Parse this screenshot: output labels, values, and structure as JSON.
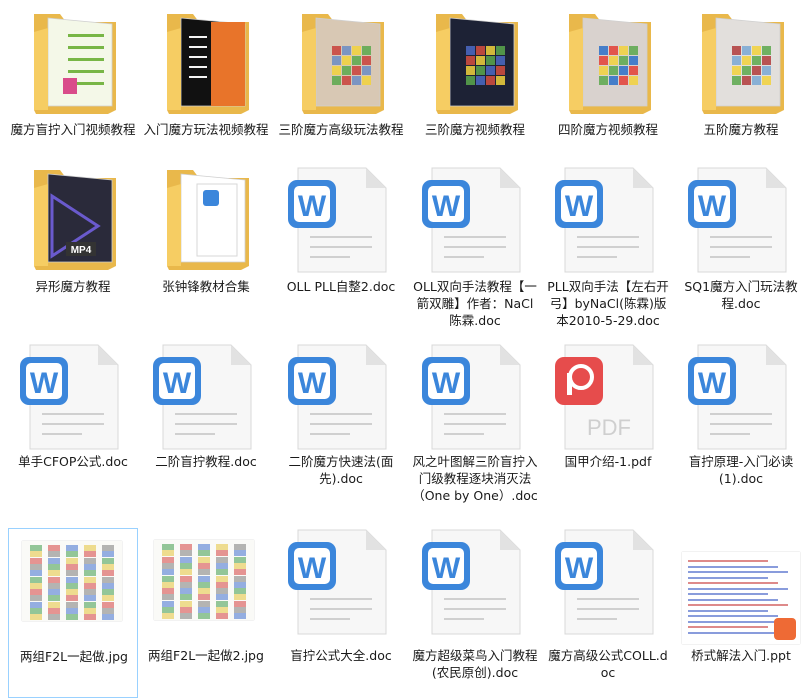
{
  "files": [
    {
      "name": "魔方盲拧入门视频教程",
      "type": "folder",
      "theme": "green"
    },
    {
      "name": "入门魔方玩法视频教程",
      "type": "folder",
      "theme": "orange"
    },
    {
      "name": "三阶魔方高级玩法教程",
      "type": "folder",
      "theme": "photo"
    },
    {
      "name": "三阶魔方视频教程",
      "type": "folder",
      "theme": "dark"
    },
    {
      "name": "四阶魔方视频教程",
      "type": "folder",
      "theme": "cube"
    },
    {
      "name": "五阶魔方教程",
      "type": "folder",
      "theme": "cube2"
    },
    {
      "name": "异形魔方教程",
      "type": "folder",
      "theme": "mp4"
    },
    {
      "name": "张钟锋教材合集",
      "type": "folder",
      "theme": "word"
    },
    {
      "name": "OLL PLL自整2.doc",
      "type": "doc"
    },
    {
      "name": "OLL双向手法教程【一箭双雕】作者：NaCl陈霖.doc",
      "type": "doc"
    },
    {
      "name": "PLL双向手法【左右开弓】byNaCl(陈霖)版本2010-5-29.doc",
      "type": "doc"
    },
    {
      "name": "SQ1魔方入门玩法教程.doc",
      "type": "doc"
    },
    {
      "name": "单手CFOP公式.doc",
      "type": "doc"
    },
    {
      "name": "二阶盲拧教程.doc",
      "type": "doc"
    },
    {
      "name": "二阶魔方快速法(面先).doc",
      "type": "doc"
    },
    {
      "name": "风之叶图解三阶盲拧入门级教程逐块消灭法（One by One）.doc",
      "type": "doc"
    },
    {
      "name": "国甲介绍-1.pdf",
      "type": "pdf"
    },
    {
      "name": "盲拧原理-入门必读(1).doc",
      "type": "doc"
    },
    {
      "name": "两组F2L一起做.jpg",
      "type": "jpg",
      "selected": true
    },
    {
      "name": "两组F2L一起做2.jpg",
      "type": "jpg"
    },
    {
      "name": "盲拧公式大全.doc",
      "type": "doc"
    },
    {
      "name": "魔方超级菜鸟入门教程(农民原创).doc",
      "type": "doc"
    },
    {
      "name": "魔方高级公式COLL.doc",
      "type": "doc"
    },
    {
      "name": "桥式解法入门.ppt",
      "type": "ppt"
    }
  ],
  "icons": {
    "doc_letter": "W",
    "pdf_text": "PDF",
    "mp4_text": "MP4",
    "word_blue": "#3b86db",
    "pdf_red": "#e64c4c",
    "ppt_orange": "#ee6a35",
    "folder_yellow": "#f6cd63"
  }
}
